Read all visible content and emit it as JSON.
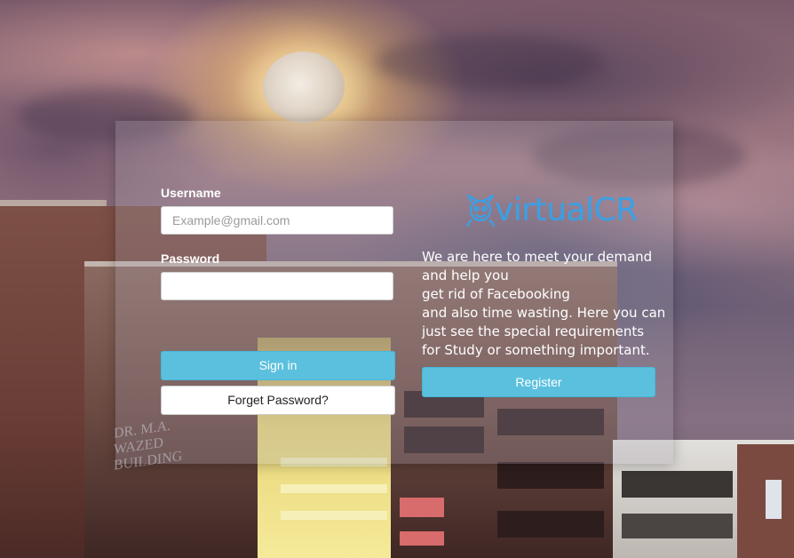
{
  "login": {
    "username_label": "Username",
    "username_placeholder": "Example@gmail.com",
    "username_value": "",
    "password_label": "Password",
    "password_value": "",
    "signin_label": "Sign in",
    "forgot_label": "Forget Password?"
  },
  "brand": {
    "name": "virtualCR",
    "color": "#3aa0e6"
  },
  "description": {
    "lines": [
      "We are here to meet your demand",
      "and help you",
      "get rid of Facebooking",
      "and also time wasting. Here you can",
      "just see the special requirements",
      "for Study or something important."
    ]
  },
  "register": {
    "label": "Register"
  },
  "background_sign": {
    "line1": "DR. M.A. WAZED",
    "line2": "BUILDING"
  },
  "colors": {
    "primary": "#5bc0de",
    "panel": "rgba(170,160,175,0.28)"
  }
}
